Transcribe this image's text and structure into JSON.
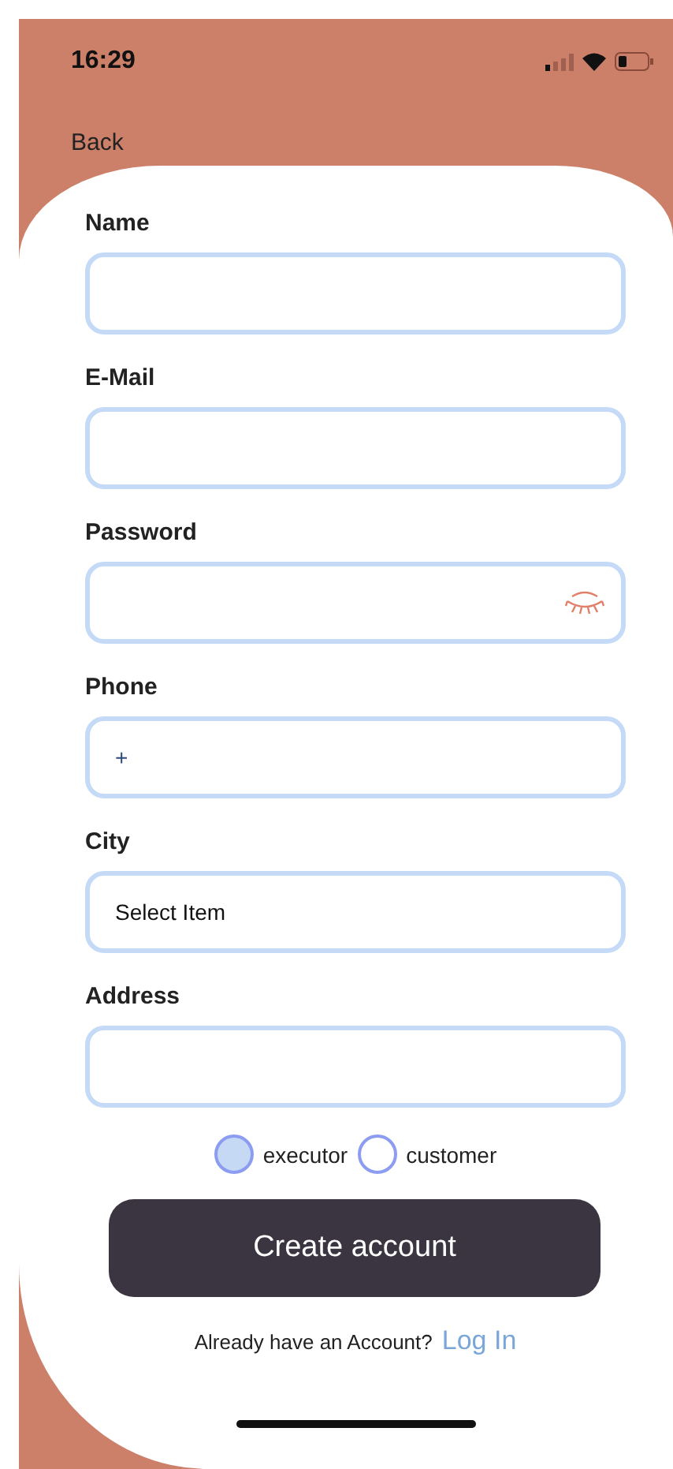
{
  "status_bar": {
    "time": "16:29"
  },
  "back": "Back",
  "fields": [
    {
      "label": "Name",
      "kind": "text"
    },
    {
      "label": "E-Mail",
      "kind": "text"
    },
    {
      "label": "Password",
      "kind": "password"
    },
    {
      "label": "Phone",
      "kind": "text",
      "value": "+"
    },
    {
      "label": "City",
      "kind": "select",
      "value": "Select Item"
    },
    {
      "label": "Address",
      "kind": "text"
    }
  ],
  "roles": [
    {
      "label": "executor",
      "selected": true
    },
    {
      "label": "customer",
      "selected": false
    }
  ],
  "submit": "Create account",
  "login_prompt": {
    "text": "Already have an Account?",
    "link": "Log In"
  }
}
